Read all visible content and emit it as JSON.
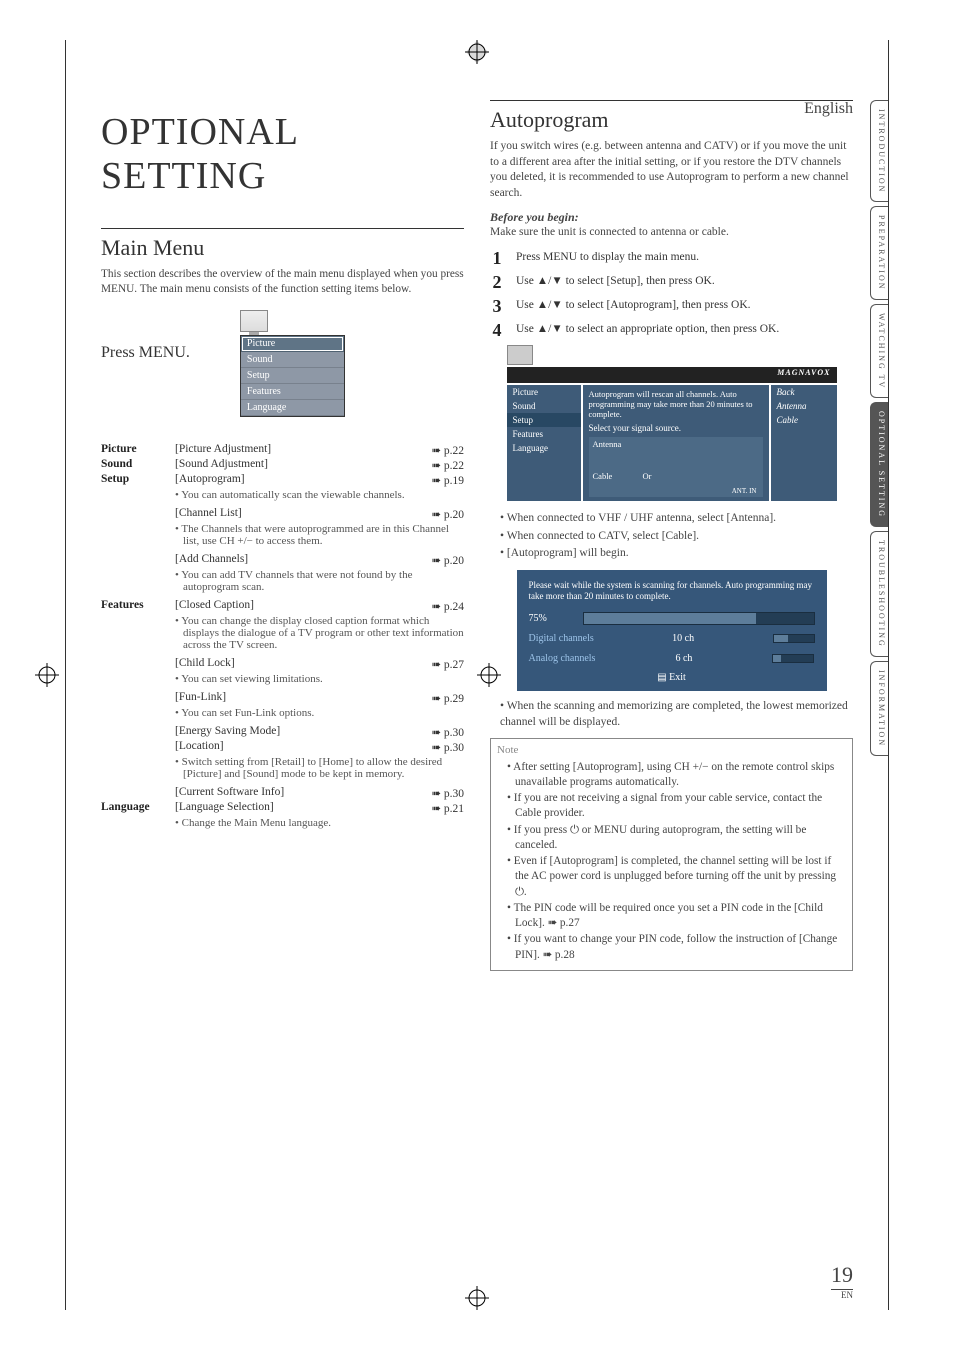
{
  "language_label": "English",
  "title": "OPTIONAL SETTING",
  "main_menu": {
    "heading": "Main Menu",
    "intro": "This section describes the overview of the main menu displayed when you press MENU. The main menu consists of the function setting items below.",
    "press_menu": "Press MENU.",
    "osd_items": [
      "Picture",
      "Sound",
      "Setup",
      "Features",
      "Language"
    ],
    "osd_selected_index": 0
  },
  "menu_rows": [
    {
      "cat": "Picture",
      "label": "[Picture Adjustment]",
      "page": "p.22",
      "desc": ""
    },
    {
      "cat": "Sound",
      "label": "[Sound Adjustment]",
      "page": "p.22",
      "desc": ""
    },
    {
      "cat": "Setup",
      "label": "[Autoprogram]",
      "page": "p.19",
      "desc": "• You can automatically scan the viewable channels."
    },
    {
      "cat": "",
      "label": "[Channel List]",
      "page": "p.20",
      "desc": "• The Channels that were autoprogrammed are in this Channel list, use CH +/− to access them."
    },
    {
      "cat": "",
      "label": "[Add Channels]",
      "page": "p.20",
      "desc": "• You can add TV channels that were not found by the autoprogram scan."
    },
    {
      "cat": "Features",
      "label": "[Closed Caption]",
      "page": "p.24",
      "desc": "• You can change the display closed caption format which displays the dialogue of a TV program or other text information across the TV screen."
    },
    {
      "cat": "",
      "label": "[Child Lock]",
      "page": "p.27",
      "desc": "• You can set viewing limitations."
    },
    {
      "cat": "",
      "label": "[Fun-Link]",
      "page": "p.29",
      "desc": "• You can set Fun-Link options."
    },
    {
      "cat": "",
      "label": "[Energy Saving Mode]",
      "page": "p.30",
      "desc": ""
    },
    {
      "cat": "",
      "label": "[Location]",
      "page": "p.30",
      "desc": "• Switch setting from [Retail] to [Home] to allow the desired [Picture] and [Sound] mode to be kept in memory."
    },
    {
      "cat": "",
      "label": "[Current Software Info]",
      "page": "p.30",
      "desc": ""
    },
    {
      "cat": "Language",
      "label": "[Language Selection]",
      "page": "p.21",
      "desc": "• Change the Main Menu language."
    }
  ],
  "autoprogram": {
    "heading": "Autoprogram",
    "intro": "If you switch wires (e.g. between antenna and CATV) or if you move the unit to a different area after the initial setting, or if you restore the DTV channels you deleted, it is recommended to use Autoprogram to perform a new channel search.",
    "before_label": "Before you begin:",
    "before_text": "Make sure the unit is connected to antenna or cable.",
    "steps": [
      "Press MENU to display the main menu.",
      "Use ▲/▼ to select [Setup], then press OK.",
      "Use ▲/▼ to select [Autoprogram], then press OK.",
      "Use ▲/▼ to select an appropriate option, then press OK."
    ],
    "osd2_logo": "MAGNAVOX",
    "osd2_left": [
      "Picture",
      "Sound",
      "Setup",
      "Features",
      "Language"
    ],
    "osd2_left_selected": 2,
    "osd2_msg": "Autoprogram will rescan all channels. Auto programming may take more than 20 minutes to complete.",
    "osd2_q": "Select your signal source.",
    "osd2_right": [
      "Back",
      "Antenna",
      "Cable"
    ],
    "osd2_diagram_labels": {
      "antenna": "Antenna",
      "cable": "Cable",
      "or": "Or",
      "ant_in": "ANT. IN"
    },
    "post_bullets": [
      "When connected to VHF / UHF antenna, select [Antenna].",
      "When connected to CATV, select [Cable].",
      "[Autoprogram] will begin."
    ],
    "progress": {
      "msg": "Please wait while the system is scanning for channels. Auto programming may take more than 20 minutes to complete.",
      "percent_label": "75%",
      "percent": 75,
      "digital_label": "Digital channels",
      "digital_val": "10 ch",
      "digital_fill": 35,
      "analog_label": "Analog channels",
      "analog_val": "6 ch",
      "analog_fill": 20,
      "exit": "Exit"
    },
    "closing": "• When the scanning and memorizing are completed, the lowest memorized channel will be displayed."
  },
  "note": {
    "heading": "Note",
    "items": [
      "After setting [Autoprogram], using CH +/− on the remote control skips unavailable programs automatically.",
      "If you are not receiving a signal from your cable service, contact the Cable provider.",
      "If you press ⏻ or MENU during autoprogram, the setting will be canceled.",
      "Even if [Autoprogram] is completed, the channel setting will be lost if the AC power cord is unplugged before turning off the unit by pressing ⏻.",
      "The PIN code will be required once you set a PIN code in the [Child Lock]. ➠ p.27",
      "If you want to change your PIN code, follow the instruction of [Change PIN]. ➠ p.28"
    ]
  },
  "side_tabs": [
    "INTRODUCTION",
    "PREPARATION",
    "WATCHING TV",
    "OPTIONAL SETTING",
    "TROUBLESHOOTING",
    "INFORMATION"
  ],
  "side_tab_active_index": 3,
  "page_number": {
    "num": "19",
    "lang": "EN"
  }
}
